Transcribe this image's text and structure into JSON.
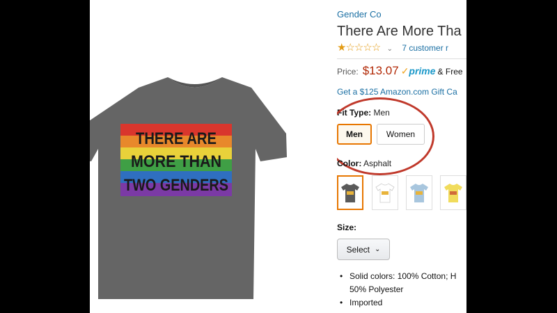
{
  "product": {
    "brand": "Gender Co",
    "title": "There Are More Tha",
    "image_text": [
      "THERE ARE",
      "MORE THAN",
      "TWO GENDERS"
    ]
  },
  "rating": {
    "stars_filled": 1,
    "stars_total": 5,
    "star_filled_glyph": "★",
    "star_empty_glyph": "☆",
    "reviews_link": "7 customer r"
  },
  "price": {
    "label": "Price:",
    "value": "$13.07",
    "prime_check": "✓",
    "prime": "prime",
    "free": "& Free"
  },
  "gift_card_link": "Get a $125 Amazon.com Gift Ca",
  "fit_type": {
    "label": "Fit Type:",
    "selected": "Men",
    "options": [
      "Men",
      "Women"
    ]
  },
  "color": {
    "label": "Color:",
    "selected": "Asphalt",
    "swatch_colors": [
      "#5a5a5a",
      "#ffffff",
      "#a8c6de",
      "#f1dc5c"
    ]
  },
  "size": {
    "label": "Size:",
    "select_label": "Select"
  },
  "features": [
    "Solid colors: 100% Cotton; H",
    "50% Polyester",
    "Imported"
  ],
  "colors": {
    "shirt": "#656565",
    "accent_orange": "#e77600",
    "circle_red": "#c0392b",
    "link_blue": "#1a6fa3",
    "price_red": "#b12704"
  }
}
